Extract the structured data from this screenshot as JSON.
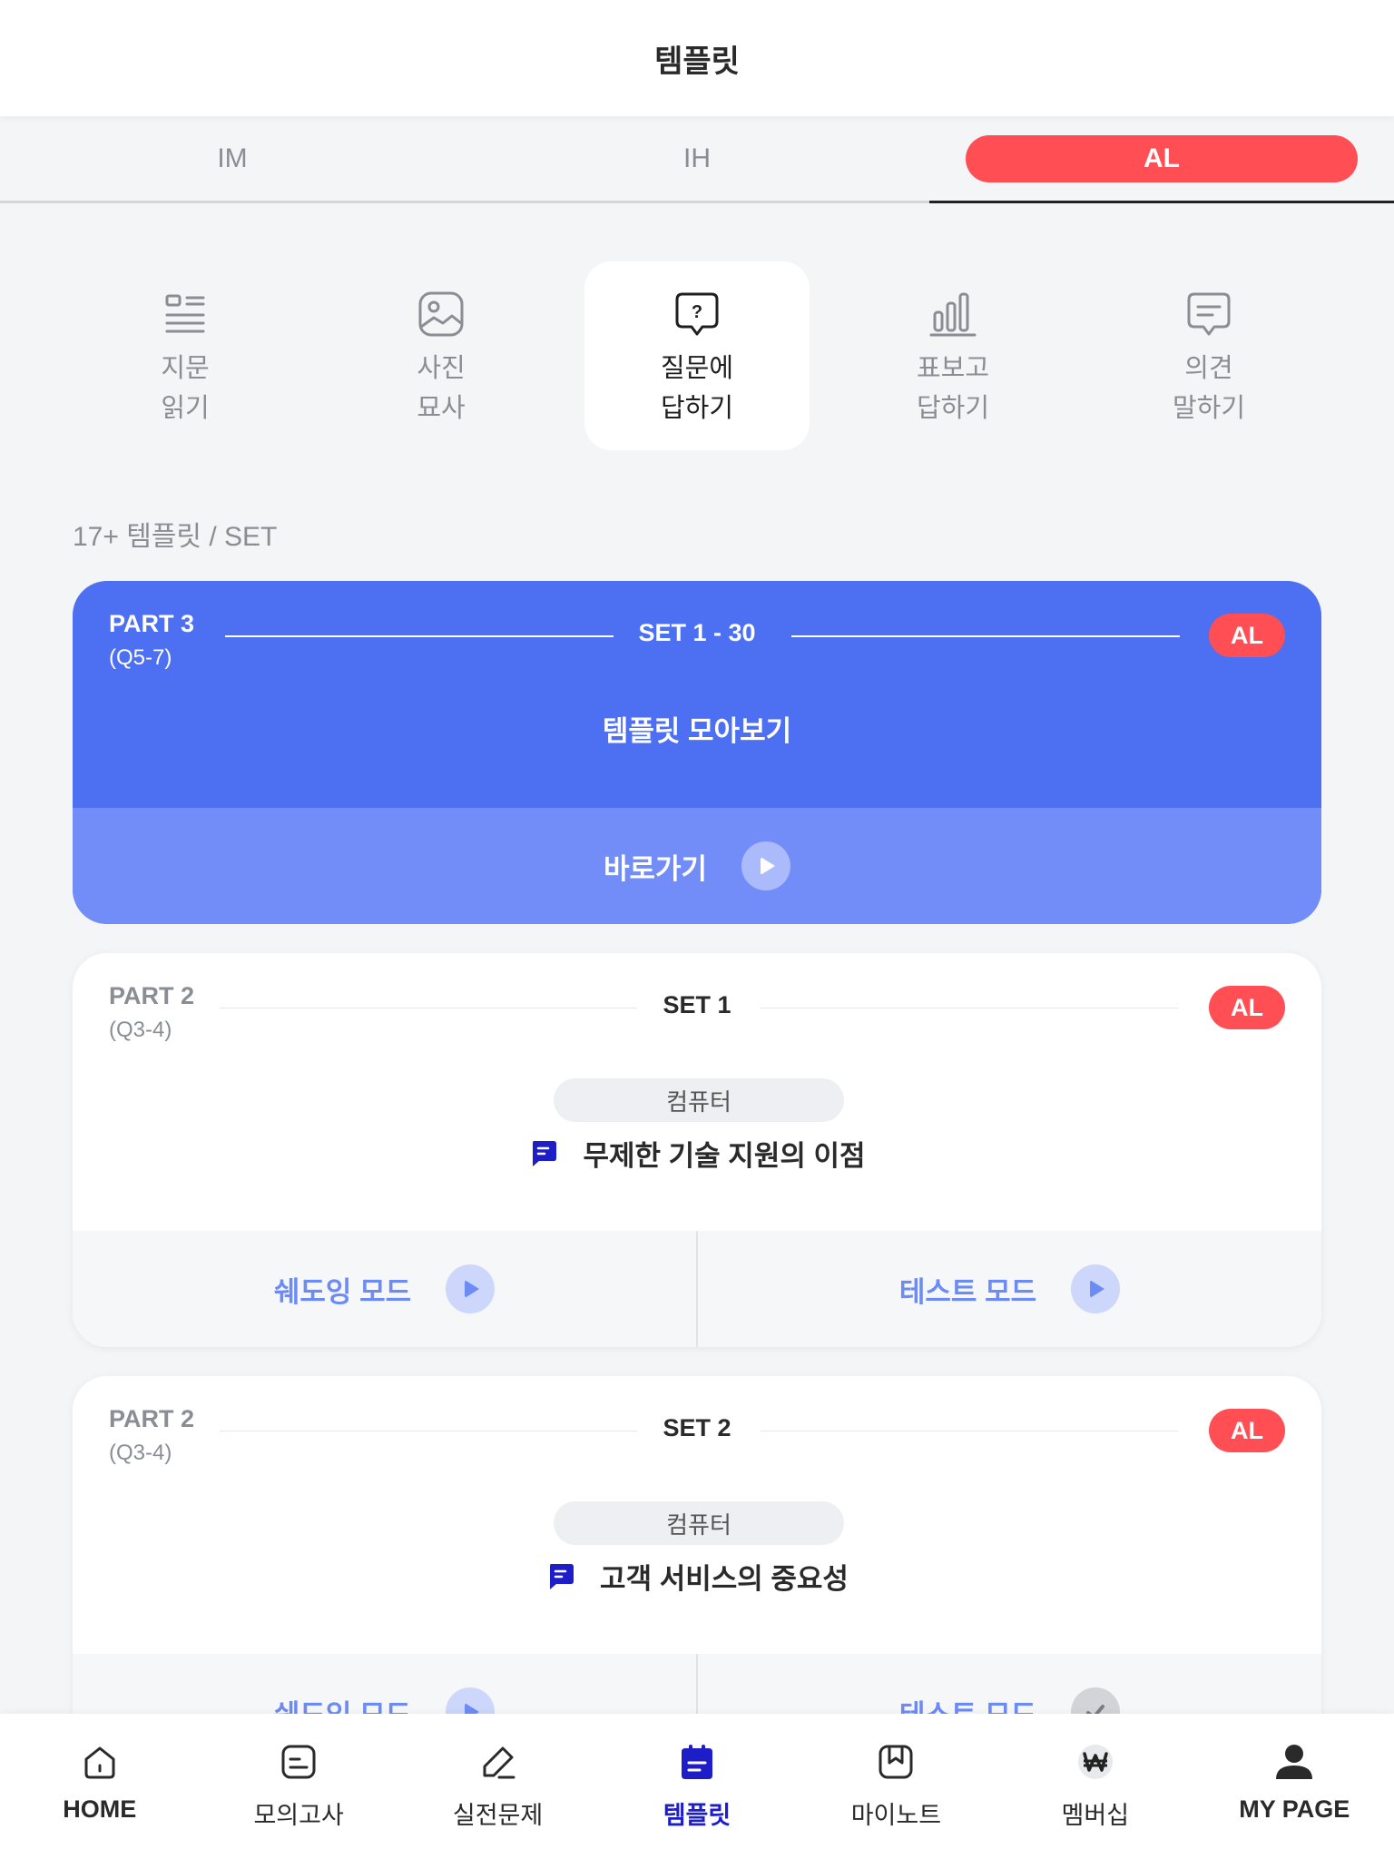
{
  "header": {
    "title": "템플릿"
  },
  "level_tabs": [
    {
      "label": "IM",
      "active": false
    },
    {
      "label": "IH",
      "active": false
    },
    {
      "label": "AL",
      "active": true
    }
  ],
  "categories": [
    {
      "label": "지문\n읽기",
      "icon": "text-lines-icon",
      "active": false
    },
    {
      "label": "사진\n묘사",
      "icon": "image-icon",
      "active": false
    },
    {
      "label": "질문에\n답하기",
      "icon": "question-bubble-icon",
      "active": true
    },
    {
      "label": "표보고\n답하기",
      "icon": "bar-chart-icon",
      "active": false
    },
    {
      "label": "의견\n말하기",
      "icon": "chat-bubble-icon",
      "active": false
    }
  ],
  "count_text": "17+ 템플릿 / SET",
  "summary_card": {
    "part": "PART 3",
    "range": "(Q5-7)",
    "set": "SET 1 - 30",
    "badge": "AL",
    "title": "템플릿 모아보기",
    "goto": "바로가기"
  },
  "sets": [
    {
      "part": "PART 2",
      "range": "(Q3-4)",
      "set": "SET 1",
      "badge": "AL",
      "topic": "컴퓨터",
      "question": "무제한 기술 지원의 이점",
      "shadowing": "쉐도잉 모드",
      "test": "테스트 모드"
    },
    {
      "part": "PART 2",
      "range": "(Q3-4)",
      "set": "SET 2",
      "badge": "AL",
      "topic": "컴퓨터",
      "question": "고객 서비스의 중요성",
      "shadowing": "쉐도잉 모드",
      "test": "테스트 모드"
    }
  ],
  "nav": [
    {
      "label": "HOME",
      "icon": "home-icon"
    },
    {
      "label": "모의고사",
      "icon": "document-icon"
    },
    {
      "label": "실전문제",
      "icon": "pencil-icon"
    },
    {
      "label": "템플릿",
      "icon": "clipboard-icon",
      "active": true
    },
    {
      "label": "마이노트",
      "icon": "bookmark-icon"
    },
    {
      "label": "멤버십",
      "icon": "won-icon"
    },
    {
      "label": "MY PAGE",
      "icon": "person-icon"
    }
  ],
  "colors": {
    "accent_red": "#ff4f55",
    "primary_blue": "#4d6ff2",
    "nav_active": "#1e1ec8"
  }
}
